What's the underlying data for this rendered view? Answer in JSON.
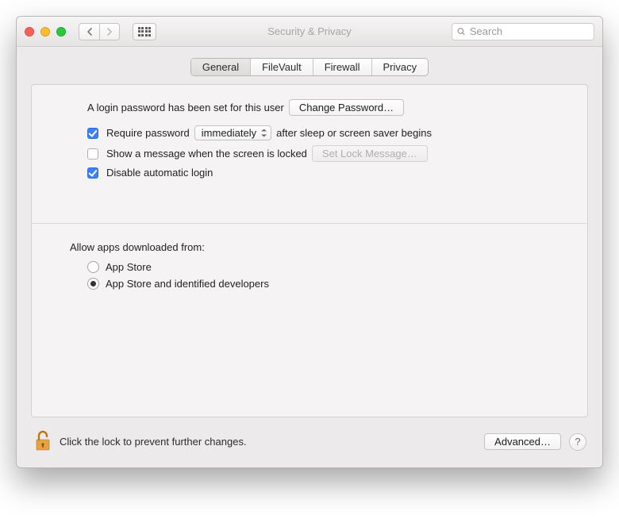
{
  "window": {
    "title": "Security & Privacy"
  },
  "toolbar": {
    "search_placeholder": "Search"
  },
  "tabs": {
    "general": "General",
    "filevault": "FileVault",
    "firewall": "Firewall",
    "privacy": "Privacy",
    "active": "General"
  },
  "general": {
    "login_password_text": "A login password has been set for this user",
    "change_password_btn": "Change Password…",
    "require_password_label": "Require password",
    "require_password_checked": true,
    "require_password_delay": "immediately",
    "require_password_suffix": "after sleep or screen saver begins",
    "show_message_label": "Show a message when the screen is locked",
    "show_message_checked": false,
    "set_lock_message_btn": "Set Lock Message…",
    "disable_auto_login_label": "Disable automatic login",
    "disable_auto_login_checked": true,
    "allow_apps_heading": "Allow apps downloaded from:",
    "radio_app_store": "App Store",
    "radio_app_store_identified": "App Store and identified developers",
    "radio_selected": "identified"
  },
  "footer": {
    "lock_text": "Click the lock to prevent further changes.",
    "advanced_btn": "Advanced…",
    "help_label": "?"
  }
}
